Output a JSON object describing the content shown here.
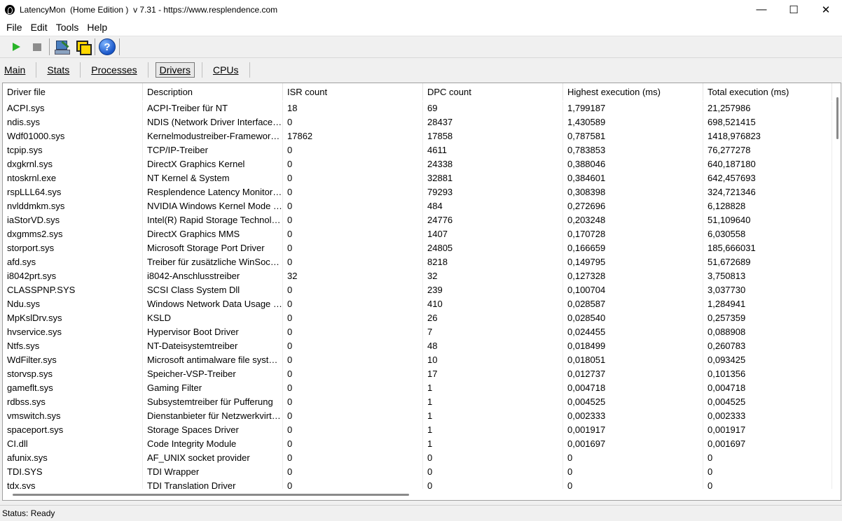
{
  "window": {
    "title": "LatencyMon  (Home Edition )  v 7.31 - https://www.resplendence.com",
    "minimize": "—",
    "maximize": "☐",
    "close": "✕"
  },
  "menu": [
    "File",
    "Edit",
    "Tools",
    "Help"
  ],
  "toolbar": {
    "buttons": [
      "play-icon",
      "stop-icon",
      "monitor-wand-icon",
      "windows-icon",
      "help-icon"
    ],
    "help_glyph": "?"
  },
  "tabs": [
    "Main",
    "Stats",
    "Processes",
    "Drivers",
    "CPUs"
  ],
  "active_tab": "Drivers",
  "table": {
    "columns": [
      "Driver file",
      "Description",
      "ISR count",
      "DPC count",
      "Highest execution (ms)",
      "Total execution (ms)"
    ],
    "rows": [
      [
        "ACPI.sys",
        "ACPI-Treiber für NT",
        "18",
        "69",
        "1,799187",
        "21,257986"
      ],
      [
        "ndis.sys",
        "NDIS (Network Driver Interface Specification)",
        "0",
        "28437",
        "1,430589",
        "698,521415"
      ],
      [
        "Wdf01000.sys",
        "Kernelmodustreiber-Framework-Laufzeit",
        "17862",
        "17858",
        "0,787581",
        "1418,976823"
      ],
      [
        "tcpip.sys",
        "TCP/IP-Treiber",
        "0",
        "4611",
        "0,783853",
        "76,277278"
      ],
      [
        "dxgkrnl.sys",
        "DirectX Graphics Kernel",
        "0",
        "24338",
        "0,388046",
        "640,187180"
      ],
      [
        "ntoskrnl.exe",
        "NT Kernel & System",
        "0",
        "32881",
        "0,384601",
        "642,457693"
      ],
      [
        "rspLLL64.sys",
        "Resplendence Latency Monitoring Driver",
        "0",
        "79293",
        "0,308398",
        "324,721346"
      ],
      [
        "nvlddmkm.sys",
        "NVIDIA Windows Kernel Mode Driver",
        "0",
        "484",
        "0,272696",
        "6,128828"
      ],
      [
        "iaStorVD.sys",
        "Intel(R) Rapid Storage Technology",
        "0",
        "24776",
        "0,203248",
        "51,109640"
      ],
      [
        "dxgmms2.sys",
        "DirectX Graphics MMS",
        "0",
        "1407",
        "0,170728",
        "6,030558"
      ],
      [
        "storport.sys",
        "Microsoft Storage Port Driver",
        "0",
        "24805",
        "0,166659",
        "185,666031"
      ],
      [
        "afd.sys",
        "Treiber für zusätzliche WinSock-Funktionen",
        "0",
        "8218",
        "0,149795",
        "51,672689"
      ],
      [
        "i8042prt.sys",
        "i8042-Anschlusstreiber",
        "32",
        "32",
        "0,127328",
        "3,750813"
      ],
      [
        "CLASSPNP.SYS",
        "SCSI Class System Dll",
        "0",
        "239",
        "0,100704",
        "3,037730"
      ],
      [
        "Ndu.sys",
        "Windows Network Data Usage Monitoring",
        "0",
        "410",
        "0,028587",
        "1,284941"
      ],
      [
        "MpKslDrv.sys",
        "KSLD",
        "0",
        "26",
        "0,028540",
        "0,257359"
      ],
      [
        "hvservice.sys",
        "Hypervisor Boot Driver",
        "0",
        "7",
        "0,024455",
        "0,088908"
      ],
      [
        "Ntfs.sys",
        "NT-Dateisystemtreiber",
        "0",
        "48",
        "0,018499",
        "0,260783"
      ],
      [
        "WdFilter.sys",
        "Microsoft antimalware file system filter",
        "0",
        "10",
        "0,018051",
        "0,093425"
      ],
      [
        "storvsp.sys",
        "Speicher-VSP-Treiber",
        "0",
        "17",
        "0,012737",
        "0,101356"
      ],
      [
        "gameflt.sys",
        "Gaming Filter",
        "0",
        "1",
        "0,004718",
        "0,004718"
      ],
      [
        "rdbss.sys",
        "Subsystemtreiber für Pufferung",
        "0",
        "1",
        "0,004525",
        "0,004525"
      ],
      [
        "vmswitch.sys",
        "Dienstanbieter für Netzwerkvirtualisierung",
        "0",
        "1",
        "0,002333",
        "0,002333"
      ],
      [
        "spaceport.sys",
        "Storage Spaces Driver",
        "0",
        "1",
        "0,001917",
        "0,001917"
      ],
      [
        "CI.dll",
        "Code Integrity Module",
        "0",
        "1",
        "0,001697",
        "0,001697"
      ],
      [
        "afunix.sys",
        "AF_UNIX socket provider",
        "0",
        "0",
        "0",
        "0"
      ],
      [
        "TDI.SYS",
        "TDI Wrapper",
        "0",
        "0",
        "0",
        "0"
      ],
      [
        "tdx.sys",
        "TDI Translation Driver",
        "0",
        "0",
        "0",
        "0"
      ]
    ]
  },
  "status": "Status: Ready"
}
